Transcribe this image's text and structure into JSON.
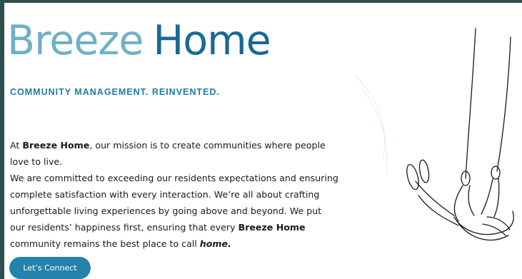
{
  "brand": {
    "word1": "Breeze",
    "word2": "Home"
  },
  "tagline": "COMMUNITY MANAGEMENT. REINVENTED.",
  "mission": {
    "p1_pre": "At ",
    "p1_brand": "Breeze Home",
    "p1_post": ", our mission is to create communities where people love to live.",
    "p2_pre": "We are committed to exceeding our residents expectations and ensuring complete satisfaction with every interaction. We’re all about crafting unforgettable living experiences by going above and beyond. We put our residents’ happiness first, ensuring that every ",
    "p2_brand": "Breeze Home",
    "p2_mid": " community remains the best place to call ",
    "p2_home": "home."
  },
  "cta": {
    "label": "Let’s Connect"
  },
  "colors": {
    "brand_light": "#6fb1c6",
    "brand_dark": "#176a95",
    "accent": "#2582ab",
    "frame": "#2f4f4f"
  },
  "illustration": {
    "icon": "swing-figure-line-art"
  }
}
